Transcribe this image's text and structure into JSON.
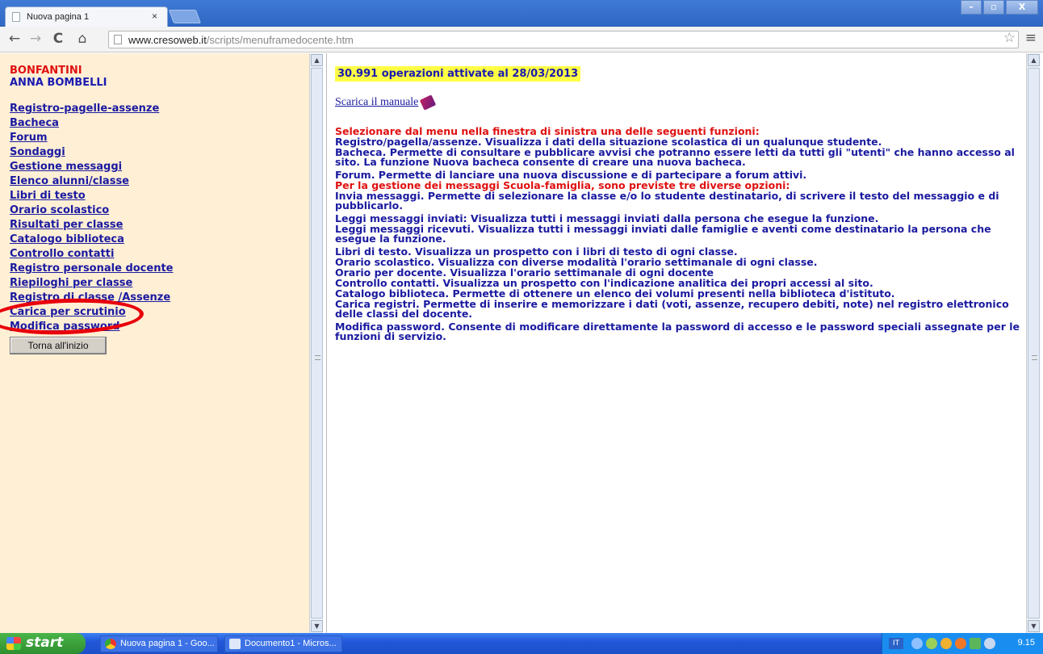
{
  "browser": {
    "tab_title": "Nuova pagina 1",
    "tab_close": "×",
    "url_host": "www.cresoweb.it",
    "url_path": "/scripts/menuframedocente.htm",
    "back_icon": "←",
    "forward_icon": "→",
    "reload_icon": "C",
    "home_icon": "⌂",
    "star_icon": "☆",
    "menu_icon": "≡",
    "minimize_label": "–",
    "maximize_label": "▫",
    "close_label": "X"
  },
  "left": {
    "name1": "BONFANTINI",
    "name2": "ANNA BOMBELLI",
    "menu": [
      "Registro-pagelle-assenze",
      "Bacheca",
      "Forum",
      "Sondaggi",
      "Gestione messaggi",
      "Elenco alunni/classe",
      "Libri di testo",
      "Orario scolastico",
      "Risultati per classe",
      "Catalogo biblioteca",
      "Controllo contatti",
      "Registro personale docente",
      "Riepiloghi per classe",
      "Registro di classe /Assenze",
      "Carica per scrutinio",
      "Modifica password"
    ],
    "restart_button": "Torna all'inizio"
  },
  "right": {
    "operations": "30.991 operazioni attivate al 28/03/2013",
    "manual_link": "Scarica il manuale",
    "lines": [
      {
        "text": "Selezionare dal menu nella finestra di sinistra una delle seguenti funzioni:",
        "red": true
      },
      {
        "text": "Registro/pagella/assenze. Visualizza i dati della situazione scolastica  di un qualunque studente.",
        "red": false
      },
      {
        "text": "Bacheca. Permette di consultare e pubblicare avvisi che potranno essere letti da tutti gli  \"utenti\" che hanno accesso al sito. La funzione Nuova bacheca consente di creare una nuova bacheca.",
        "red": false
      },
      {
        "text": "Forum. Permette di lanciare una nuova discussione e di partecipare a forum attivi.",
        "red": false
      },
      {
        "text": "Per la gestione dei messaggi Scuola-famiglia, sono previste tre diverse opzioni:",
        "red": true
      },
      {
        "text": "Invia messaggi. Permette di selezionare la classe e/o lo studente destinatario, di scrivere il testo del messaggio e di pubblicarlo.",
        "red": false
      },
      {
        "text": "Leggi messaggi inviati: Visualizza tutti i messaggi inviati dalla persona che esegue la funzione.",
        "red": false
      },
      {
        "text": "Leggi messaggi ricevuti. Visualizza tutti i messaggi inviati dalle famiglie e aventi come destinatario la persona che esegue la funzione.",
        "red": false
      },
      {
        "text": "Libri di testo. Visualizza un prospetto con i libri di testo di ogni classe.",
        "red": false
      },
      {
        "text": "Orario scolastico. Visualizza con diverse modalità l'orario settimanale di ogni classe.",
        "red": false
      },
      {
        "text": "Orario per docente. Visualizza l'orario settimanale di ogni docente",
        "red": false
      },
      {
        "text": "Controllo contatti. Visualizza un prospetto con l'indicazione analitica dei propri accessi al sito.",
        "red": false
      },
      {
        "text": "Catalogo biblioteca. Permette di ottenere un elenco dei volumi presenti nella biblioteca d'istituto.",
        "red": false
      },
      {
        "text": "Carica registri. Permette di inserire e memorizzare i dati (voti, assenze, recupero debiti, note) nel registro elettronico delle classi del docente.",
        "red": false
      },
      {
        "text": "Modifica password. Consente di  modificare direttamente la password di accesso e le password speciali assegnate per le funzioni di servizio.",
        "red": false
      }
    ]
  },
  "taskbar": {
    "start_label": "start",
    "item1": "Nuova pagina 1 - Goo...",
    "item2": "Documento1 - Micros...",
    "lang": "IT",
    "clock": "9.15"
  },
  "colors": {
    "highlight": "#ffff44",
    "link": "#1a1aa0",
    "red_text": "#e01010",
    "annotation_circle": "#e8000a"
  }
}
